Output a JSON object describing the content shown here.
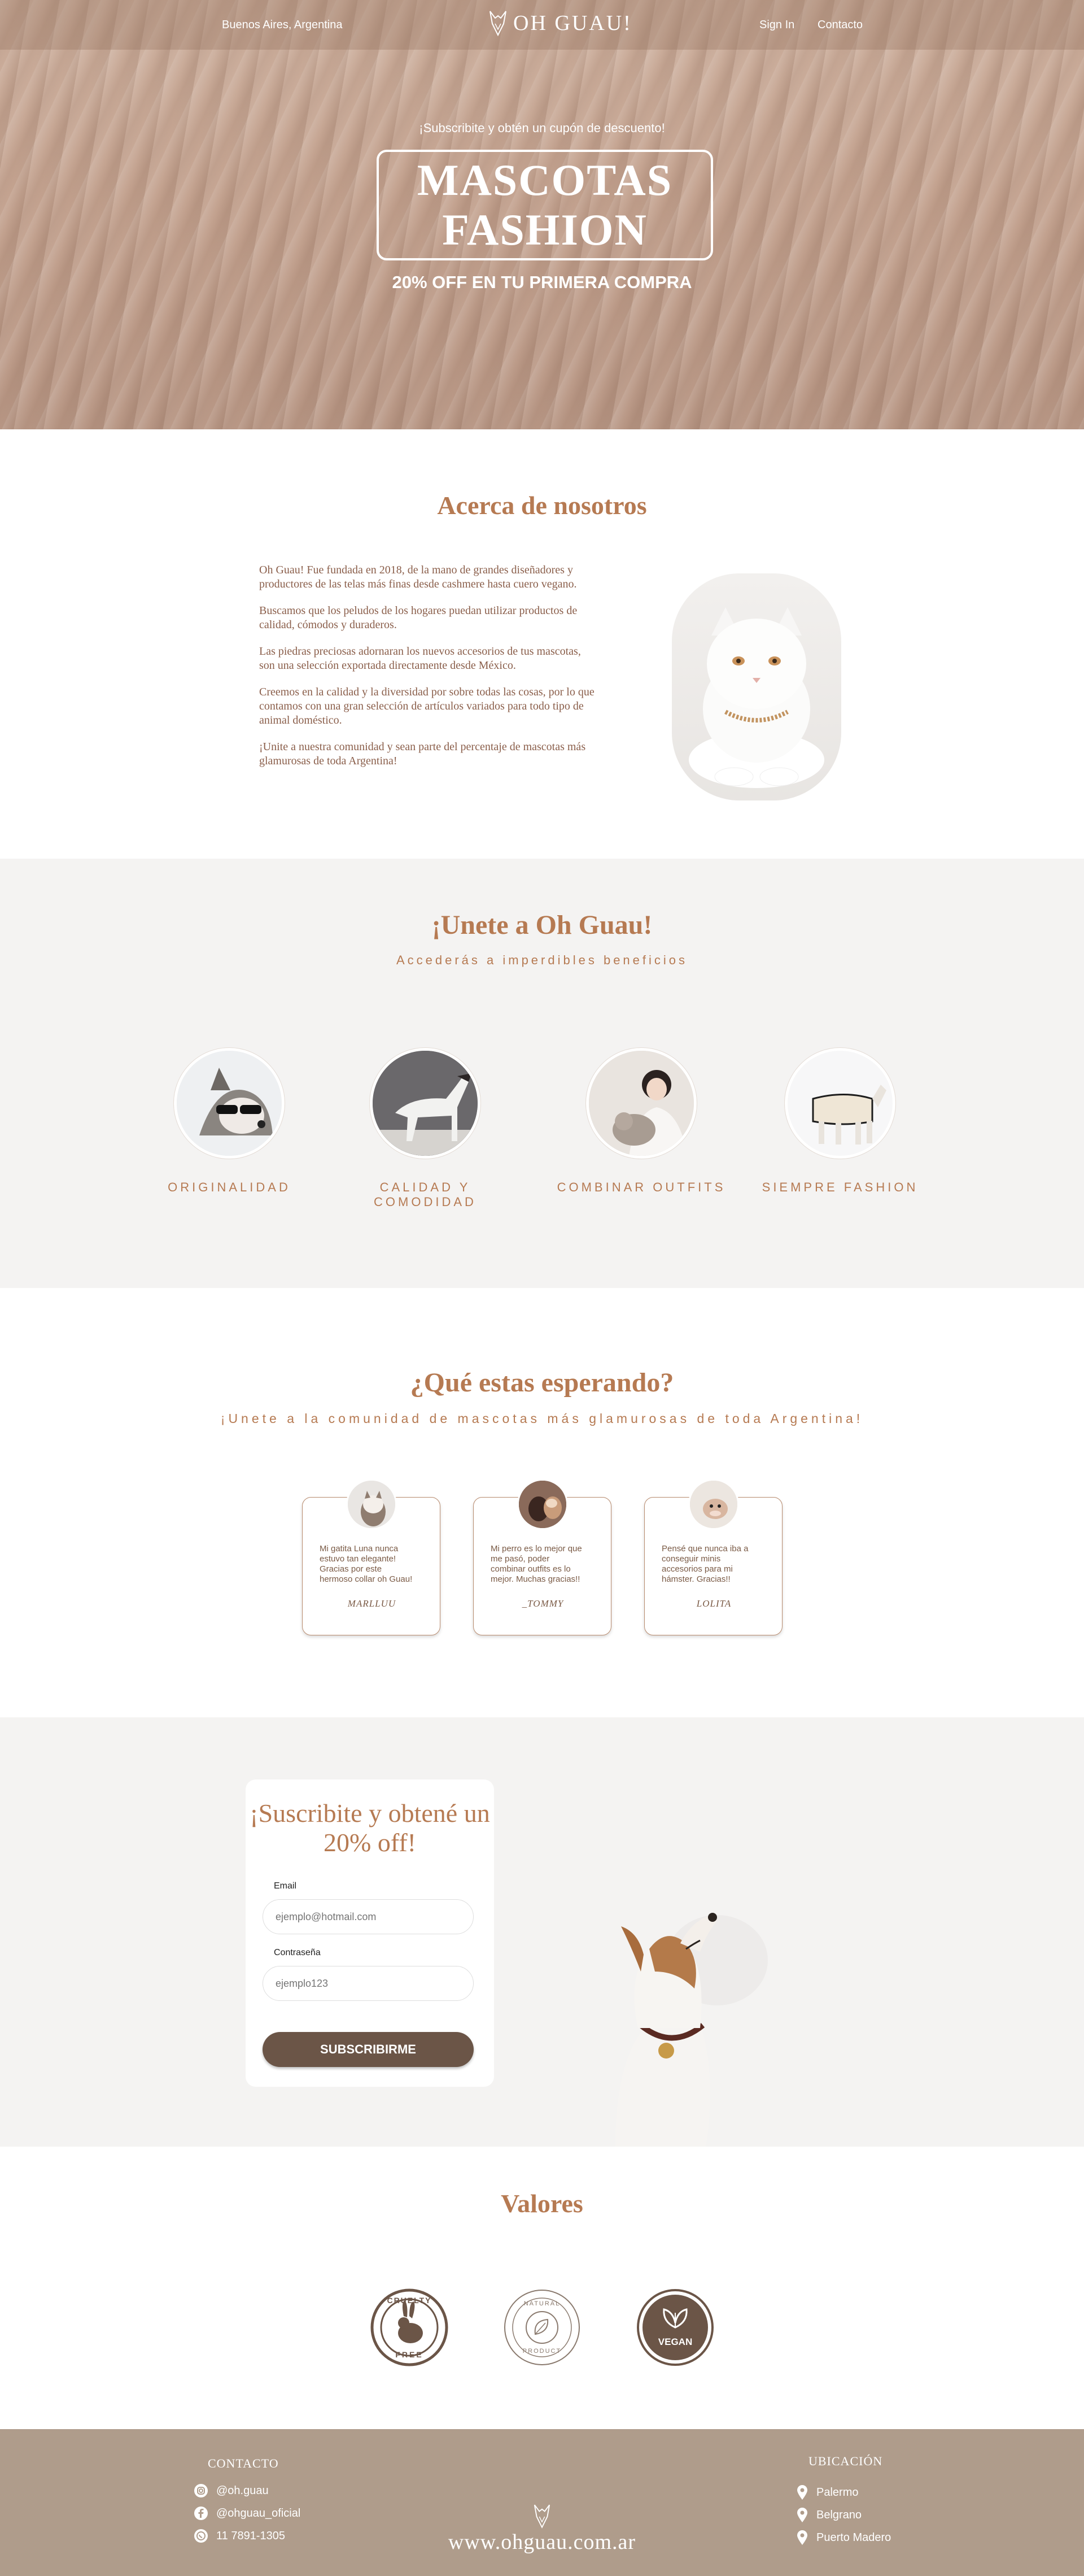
{
  "header": {
    "location": "Buenos Aires, Argentina",
    "brand": "OH GUAU!",
    "nav": [
      "Sign In",
      "Contacto"
    ]
  },
  "hero": {
    "subscribe_line": "¡Subscribite y obtén un cupón de descuento!",
    "title_line1": "MASCOTAS",
    "title_line2": "FASHION",
    "discount": "20% OFF EN TU PRIMERA COMPRA"
  },
  "about": {
    "title": "Acerca de nosotros",
    "paragraphs": [
      "Oh Guau! Fue fundada en 2018, de la mano de grandes diseñadores y productores de las telas más finas desde cashmere hasta cuero vegano.",
      "Buscamos que los peludos de los hogares puedan utilizar productos de calidad, cómodos y duraderos.",
      "Las piedras preciosas adornaran los nuevos accesorios de tus mascotas, son una selección exportada directamente desde México.",
      "Creemos en la calidad y la diversidad por sobre todas las cosas, por lo que contamos con una gran selección de artículos variados para todo tipo de animal doméstico.",
      "¡Unite a nuestra comunidad y sean parte del percentaje de mascotas más glamurosas de toda Argentina!"
    ]
  },
  "join": {
    "title": "¡Unete a Oh Guau!",
    "subtitle": "Accederás a imperdibles beneficios",
    "benefits": [
      "ORIGINALIDAD",
      "CALIDAD Y COMODIDAD",
      "COMBINAR OUTFITS",
      "SIEMPRE FASHION"
    ]
  },
  "reviews": {
    "title": "¿Qué estas esperando?",
    "subtitle": "¡Unete a la comunidad de mascotas más glamurosas de toda Argentina!",
    "items": [
      {
        "text": "Mi gatita Luna nunca estuvo tan elegante! Gracias por este hermoso collar oh Guau!",
        "author": "MARLLUU"
      },
      {
        "text": "Mi perro es lo mejor que me pasó, poder combinar outfits es lo mejor. Muchas gracias!!",
        "author": "_TOMMY"
      },
      {
        "text": "Pensé que nunca iba a conseguir minis accesorios para mi hámster. Gracias!!",
        "author": "LOLITA"
      }
    ]
  },
  "subscribe": {
    "title": "¡Suscribite y obtené un 20% off!",
    "email_label": "Email",
    "email_placeholder": "ejemplo@hotmail.com",
    "password_label": "Contraseña",
    "password_placeholder": "ejemplo123",
    "button": "SUBSCRIBIRME"
  },
  "values": {
    "title": "Valores",
    "badges": [
      {
        "top": "CRUELTY",
        "bottom": "FREE"
      },
      {
        "top": "NATURAL",
        "bottom": "PRODUCT"
      },
      {
        "top": "",
        "bottom": "VEGAN"
      }
    ]
  },
  "footer": {
    "contact_title": "CONTACTO",
    "contacts": [
      {
        "icon": "instagram-icon",
        "text": "@oh.guau"
      },
      {
        "icon": "facebook-icon",
        "text": "@ohguau_oficial"
      },
      {
        "icon": "whatsapp-icon",
        "text": "11 7891-1305"
      }
    ],
    "location_title": "UBICACIÓN",
    "locations": [
      "Palermo",
      "Belgrano",
      "Puerto Madero"
    ],
    "site": "www.ohguau.com.ar"
  },
  "colors": {
    "accent": "#b67a52",
    "button": "#6b5547",
    "footer": "#af9c8b",
    "section_bg": "#f4f3f2"
  }
}
